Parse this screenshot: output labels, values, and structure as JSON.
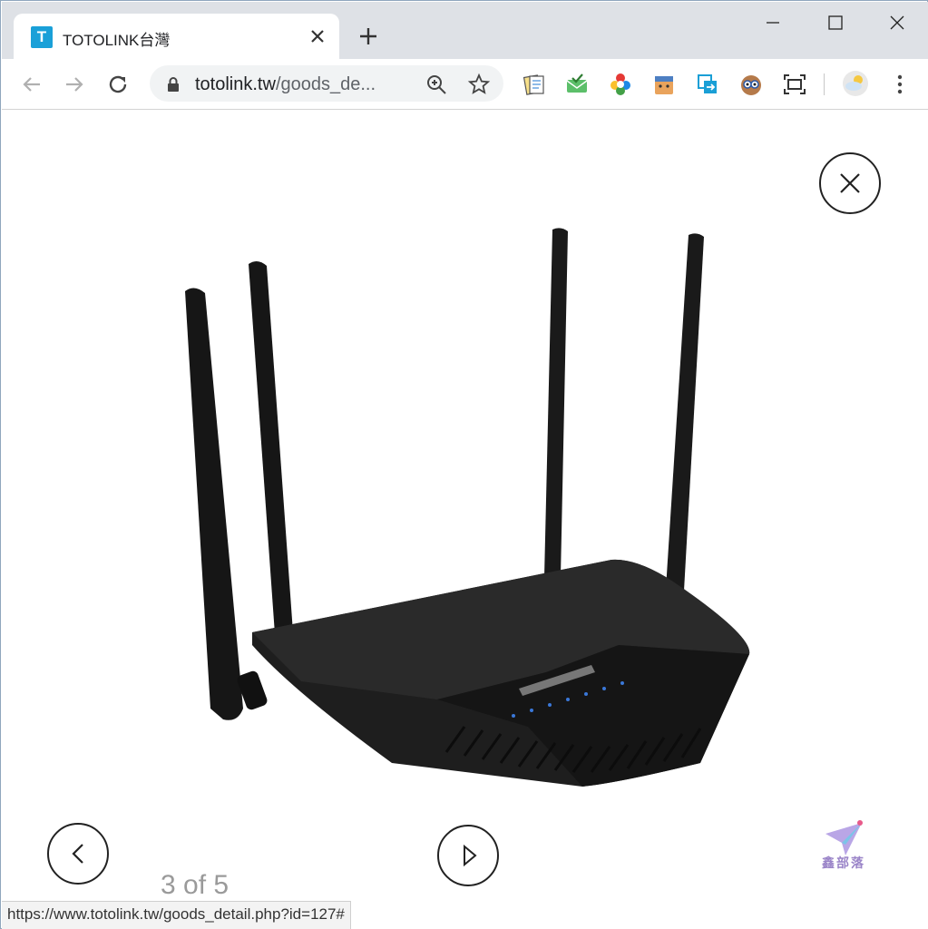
{
  "browser": {
    "tab": {
      "title": "TOTOLINK台灣",
      "favicon_letter": "T",
      "favicon_color": "#1aa0d8"
    },
    "url": {
      "host": "totolink.tw",
      "path": "/goods_de..."
    },
    "extensions": [
      "notes-icon",
      "mail-check-icon",
      "colorful-logo-icon",
      "face-icon",
      "share-icon",
      "owl-icon",
      "screenshot-icon"
    ],
    "profile": "avatar"
  },
  "viewer": {
    "counter": "3 of 5",
    "image_alt": "TOTOLINK router"
  },
  "status_bar": {
    "url": "https://www.totolink.tw/goods_detail.php?id=127#"
  },
  "watermark": {
    "text": "鑫部落"
  }
}
